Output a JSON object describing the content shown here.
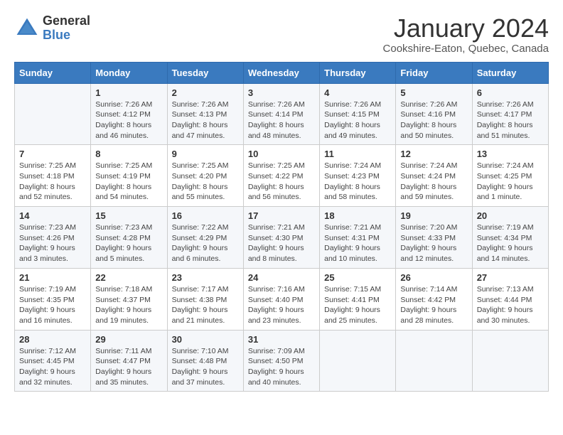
{
  "logo": {
    "general": "General",
    "blue": "Blue"
  },
  "title": "January 2024",
  "subtitle": "Cookshire-Eaton, Quebec, Canada",
  "headers": [
    "Sunday",
    "Monday",
    "Tuesday",
    "Wednesday",
    "Thursday",
    "Friday",
    "Saturday"
  ],
  "weeks": [
    [
      {
        "day": "",
        "info": ""
      },
      {
        "day": "1",
        "info": "Sunrise: 7:26 AM\nSunset: 4:12 PM\nDaylight: 8 hours\nand 46 minutes."
      },
      {
        "day": "2",
        "info": "Sunrise: 7:26 AM\nSunset: 4:13 PM\nDaylight: 8 hours\nand 47 minutes."
      },
      {
        "day": "3",
        "info": "Sunrise: 7:26 AM\nSunset: 4:14 PM\nDaylight: 8 hours\nand 48 minutes."
      },
      {
        "day": "4",
        "info": "Sunrise: 7:26 AM\nSunset: 4:15 PM\nDaylight: 8 hours\nand 49 minutes."
      },
      {
        "day": "5",
        "info": "Sunrise: 7:26 AM\nSunset: 4:16 PM\nDaylight: 8 hours\nand 50 minutes."
      },
      {
        "day": "6",
        "info": "Sunrise: 7:26 AM\nSunset: 4:17 PM\nDaylight: 8 hours\nand 51 minutes."
      }
    ],
    [
      {
        "day": "7",
        "info": "Sunrise: 7:25 AM\nSunset: 4:18 PM\nDaylight: 8 hours\nand 52 minutes."
      },
      {
        "day": "8",
        "info": "Sunrise: 7:25 AM\nSunset: 4:19 PM\nDaylight: 8 hours\nand 54 minutes."
      },
      {
        "day": "9",
        "info": "Sunrise: 7:25 AM\nSunset: 4:20 PM\nDaylight: 8 hours\nand 55 minutes."
      },
      {
        "day": "10",
        "info": "Sunrise: 7:25 AM\nSunset: 4:22 PM\nDaylight: 8 hours\nand 56 minutes."
      },
      {
        "day": "11",
        "info": "Sunrise: 7:24 AM\nSunset: 4:23 PM\nDaylight: 8 hours\nand 58 minutes."
      },
      {
        "day": "12",
        "info": "Sunrise: 7:24 AM\nSunset: 4:24 PM\nDaylight: 8 hours\nand 59 minutes."
      },
      {
        "day": "13",
        "info": "Sunrise: 7:24 AM\nSunset: 4:25 PM\nDaylight: 9 hours\nand 1 minute."
      }
    ],
    [
      {
        "day": "14",
        "info": "Sunrise: 7:23 AM\nSunset: 4:26 PM\nDaylight: 9 hours\nand 3 minutes."
      },
      {
        "day": "15",
        "info": "Sunrise: 7:23 AM\nSunset: 4:28 PM\nDaylight: 9 hours\nand 5 minutes."
      },
      {
        "day": "16",
        "info": "Sunrise: 7:22 AM\nSunset: 4:29 PM\nDaylight: 9 hours\nand 6 minutes."
      },
      {
        "day": "17",
        "info": "Sunrise: 7:21 AM\nSunset: 4:30 PM\nDaylight: 9 hours\nand 8 minutes."
      },
      {
        "day": "18",
        "info": "Sunrise: 7:21 AM\nSunset: 4:31 PM\nDaylight: 9 hours\nand 10 minutes."
      },
      {
        "day": "19",
        "info": "Sunrise: 7:20 AM\nSunset: 4:33 PM\nDaylight: 9 hours\nand 12 minutes."
      },
      {
        "day": "20",
        "info": "Sunrise: 7:19 AM\nSunset: 4:34 PM\nDaylight: 9 hours\nand 14 minutes."
      }
    ],
    [
      {
        "day": "21",
        "info": "Sunrise: 7:19 AM\nSunset: 4:35 PM\nDaylight: 9 hours\nand 16 minutes."
      },
      {
        "day": "22",
        "info": "Sunrise: 7:18 AM\nSunset: 4:37 PM\nDaylight: 9 hours\nand 19 minutes."
      },
      {
        "day": "23",
        "info": "Sunrise: 7:17 AM\nSunset: 4:38 PM\nDaylight: 9 hours\nand 21 minutes."
      },
      {
        "day": "24",
        "info": "Sunrise: 7:16 AM\nSunset: 4:40 PM\nDaylight: 9 hours\nand 23 minutes."
      },
      {
        "day": "25",
        "info": "Sunrise: 7:15 AM\nSunset: 4:41 PM\nDaylight: 9 hours\nand 25 minutes."
      },
      {
        "day": "26",
        "info": "Sunrise: 7:14 AM\nSunset: 4:42 PM\nDaylight: 9 hours\nand 28 minutes."
      },
      {
        "day": "27",
        "info": "Sunrise: 7:13 AM\nSunset: 4:44 PM\nDaylight: 9 hours\nand 30 minutes."
      }
    ],
    [
      {
        "day": "28",
        "info": "Sunrise: 7:12 AM\nSunset: 4:45 PM\nDaylight: 9 hours\nand 32 minutes."
      },
      {
        "day": "29",
        "info": "Sunrise: 7:11 AM\nSunset: 4:47 PM\nDaylight: 9 hours\nand 35 minutes."
      },
      {
        "day": "30",
        "info": "Sunrise: 7:10 AM\nSunset: 4:48 PM\nDaylight: 9 hours\nand 37 minutes."
      },
      {
        "day": "31",
        "info": "Sunrise: 7:09 AM\nSunset: 4:50 PM\nDaylight: 9 hours\nand 40 minutes."
      },
      {
        "day": "",
        "info": ""
      },
      {
        "day": "",
        "info": ""
      },
      {
        "day": "",
        "info": ""
      }
    ]
  ]
}
